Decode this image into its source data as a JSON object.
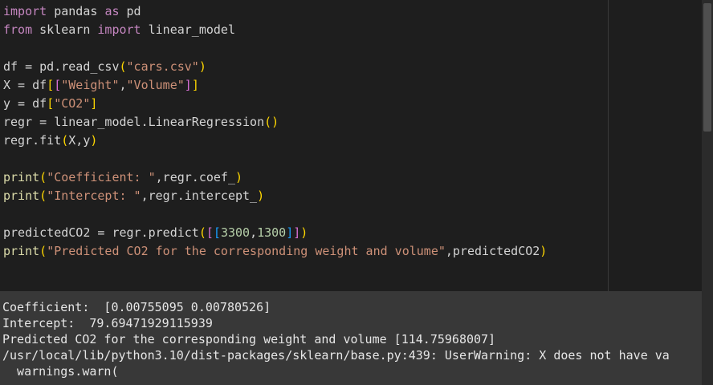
{
  "editor": {
    "lines": [
      {
        "t": [
          {
            "c": "kw",
            "v": "import"
          },
          {
            "c": "",
            "v": " pandas "
          },
          {
            "c": "kw",
            "v": "as"
          },
          {
            "c": "",
            "v": " pd"
          }
        ]
      },
      {
        "t": [
          {
            "c": "kw",
            "v": "from"
          },
          {
            "c": "",
            "v": " sklearn "
          },
          {
            "c": "kw",
            "v": "import"
          },
          {
            "c": "",
            "v": " linear_model"
          }
        ]
      },
      {
        "t": []
      },
      {
        "t": [
          {
            "c": "",
            "v": "df = pd.read_csv"
          },
          {
            "c": "b1",
            "v": "("
          },
          {
            "c": "str",
            "v": "\"cars.csv\""
          },
          {
            "c": "b1",
            "v": ")"
          }
        ]
      },
      {
        "t": [
          {
            "c": "",
            "v": "X = df"
          },
          {
            "c": "b1",
            "v": "["
          },
          {
            "c": "b2",
            "v": "["
          },
          {
            "c": "str",
            "v": "\"Weight\""
          },
          {
            "c": "",
            "v": ","
          },
          {
            "c": "str",
            "v": "\"Volume\""
          },
          {
            "c": "b2",
            "v": "]"
          },
          {
            "c": "b1",
            "v": "]"
          }
        ]
      },
      {
        "t": [
          {
            "c": "",
            "v": "y = df"
          },
          {
            "c": "b1",
            "v": "["
          },
          {
            "c": "str",
            "v": "\"CO2\""
          },
          {
            "c": "b1",
            "v": "]"
          }
        ]
      },
      {
        "t": [
          {
            "c": "",
            "v": "regr = linear_model.LinearRegression"
          },
          {
            "c": "b1",
            "v": "()"
          }
        ]
      },
      {
        "t": [
          {
            "c": "",
            "v": "regr.fit"
          },
          {
            "c": "b1",
            "v": "("
          },
          {
            "c": "",
            "v": "X,y"
          },
          {
            "c": "b1",
            "v": ")"
          }
        ]
      },
      {
        "t": []
      },
      {
        "t": [
          {
            "c": "fn",
            "v": "print"
          },
          {
            "c": "b1",
            "v": "("
          },
          {
            "c": "str",
            "v": "\"Coefficient: \""
          },
          {
            "c": "",
            "v": ",regr.coef_"
          },
          {
            "c": "b1",
            "v": ")"
          }
        ]
      },
      {
        "t": [
          {
            "c": "fn",
            "v": "print"
          },
          {
            "c": "b1",
            "v": "("
          },
          {
            "c": "str",
            "v": "\"Intercept: \""
          },
          {
            "c": "",
            "v": ",regr.intercept_"
          },
          {
            "c": "b1",
            "v": ")"
          }
        ]
      },
      {
        "t": []
      },
      {
        "t": [
          {
            "c": "",
            "v": "predictedCO2 = regr.predict"
          },
          {
            "c": "b1",
            "v": "("
          },
          {
            "c": "b2",
            "v": "["
          },
          {
            "c": "b3",
            "v": "["
          },
          {
            "c": "num",
            "v": "3300"
          },
          {
            "c": "",
            "v": ","
          },
          {
            "c": "num",
            "v": "1300"
          },
          {
            "c": "b3",
            "v": "]"
          },
          {
            "c": "b2",
            "v": "]"
          },
          {
            "c": "b1",
            "v": ")"
          }
        ]
      },
      {
        "t": [
          {
            "c": "fn",
            "v": "print"
          },
          {
            "c": "b1",
            "v": "("
          },
          {
            "c": "str",
            "v": "\"Predicted CO2 for the corresponding weight and volume\""
          },
          {
            "c": "",
            "v": ",predictedCO2"
          },
          {
            "c": "b1",
            "v": ")"
          }
        ]
      }
    ]
  },
  "output": {
    "lines": [
      "Coefficient:  [0.00755095 0.00780526]",
      "Intercept:  79.69471929115939",
      "Predicted CO2 for the corresponding weight and volume [114.75968007]",
      "/usr/local/lib/python3.10/dist-packages/sklearn/base.py:439: UserWarning: X does not have va",
      "  warnings.warn("
    ]
  },
  "colors": {
    "editor_bg": "#1e1e1e",
    "output_bg": "#383838",
    "keyword": "#c586c0",
    "string": "#ce9178",
    "function": "#dcdcaa",
    "number": "#b5cea8"
  }
}
